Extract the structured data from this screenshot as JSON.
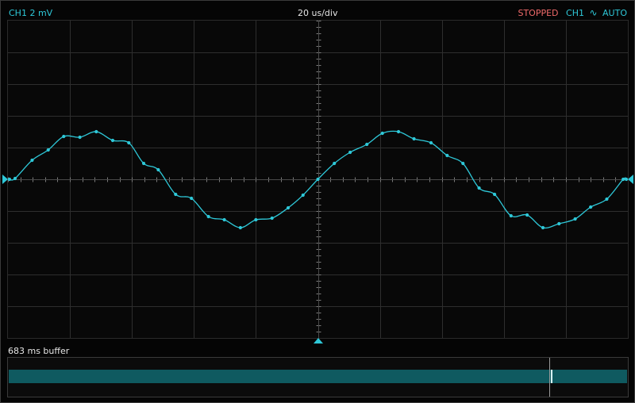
{
  "header": {
    "channel_scale": "CH1 2 mV",
    "timebase": "20 us/div",
    "run_state": "STOPPED",
    "trigger_channel": "CH1",
    "trigger_edge_symbol": "∿",
    "trigger_mode": "AUTO"
  },
  "buffer": {
    "label": "683 ms buffer",
    "position_fraction": 0.877
  },
  "colors": {
    "trace": "#2ec8d8",
    "stopped": "#f06a6a",
    "grid": "#2e2e2e",
    "text": "#e6e6e6"
  },
  "icons": {
    "ground_marker": "triangle-right-icon",
    "trigger_level_marker": "triangle-left-icon",
    "trigger_position_marker": "triangle-up-icon"
  },
  "chart_data": {
    "type": "line",
    "grid": true,
    "divisions": {
      "x": 10,
      "y": 10
    },
    "units": {
      "x": "us",
      "y": "mV"
    },
    "x_per_div": 20,
    "y_per_div": 2,
    "xlim": [
      -100,
      100
    ],
    "ylim": [
      -10,
      10
    ],
    "series": [
      {
        "points": [
          [
            -99.5,
            0.0
          ],
          [
            -97.7,
            0.05
          ],
          [
            -92.2,
            1.2
          ],
          [
            -87.0,
            1.85
          ],
          [
            -82.0,
            2.7
          ],
          [
            -76.8,
            2.65
          ],
          [
            -71.5,
            3.0
          ],
          [
            -66.2,
            2.45
          ],
          [
            -61.0,
            2.3
          ],
          [
            -56.2,
            1.0
          ],
          [
            -51.5,
            0.6
          ],
          [
            -45.9,
            -0.95
          ],
          [
            -40.8,
            -1.2
          ],
          [
            -35.3,
            -2.35
          ],
          [
            -30.2,
            -2.55
          ],
          [
            -25.0,
            -3.05
          ],
          [
            -20.0,
            -2.55
          ],
          [
            -14.8,
            -2.45
          ],
          [
            -9.6,
            -1.8
          ],
          [
            -4.8,
            -1.0
          ],
          [
            0.0,
            0.0
          ],
          [
            5.3,
            1.0
          ],
          [
            10.4,
            1.7
          ],
          [
            15.8,
            2.2
          ],
          [
            20.8,
            2.9
          ],
          [
            26.0,
            3.0
          ],
          [
            31.0,
            2.55
          ],
          [
            36.5,
            2.3
          ],
          [
            41.7,
            1.5
          ],
          [
            46.8,
            1.0
          ],
          [
            52.0,
            -0.55
          ],
          [
            57.0,
            -0.95
          ],
          [
            62.3,
            -2.3
          ],
          [
            67.5,
            -2.25
          ],
          [
            72.6,
            -3.05
          ],
          [
            77.8,
            -2.8
          ],
          [
            83.0,
            -2.5
          ],
          [
            88.0,
            -1.75
          ],
          [
            93.2,
            -1.25
          ],
          [
            98.5,
            0.0
          ],
          [
            99.5,
            0.0
          ]
        ]
      }
    ]
  }
}
